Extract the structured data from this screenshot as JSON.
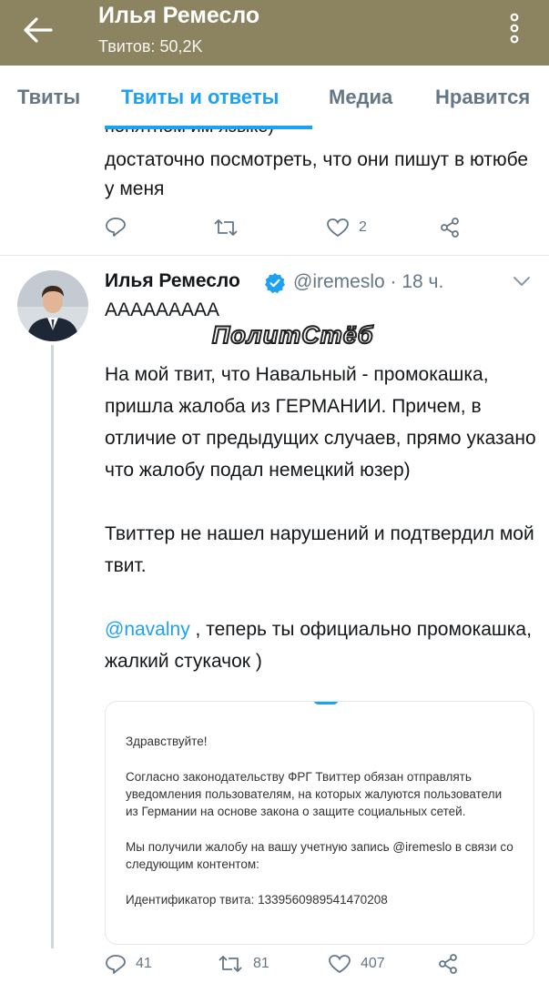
{
  "header": {
    "title": "Илья Ремесло",
    "subtitle": "Твитов: 50,2K"
  },
  "tabs": [
    {
      "label": "Твиты"
    },
    {
      "label": "Твиты и ответы"
    },
    {
      "label": "Медиа"
    },
    {
      "label": "Нравится"
    }
  ],
  "prev_tweet": {
    "cut_text": "понятном им языке)",
    "text": "достаточно посмотреть, что они пишут в ютюбе у меня",
    "likes": "2"
  },
  "tweet": {
    "name": "Илья Ремесло",
    "handle_time": "@iremeslo · 18 ч.",
    "line1": "АААААААAА",
    "watermark": "ПолитСтёб",
    "p1": "На мой твит, что Навальный - промокашка, пришла жалоба из ГЕРМАНИИ. Причем, в отличие от предыдущих случаев, прямо указано что жалобу подал немецкий юзер)",
    "p2": "Твиттер не нашел нарушений и подтвердил мой твит.",
    "mention": "@navalny",
    "p3_rest": " , теперь ты официально промокашка, жалкий стукачок )",
    "replies": "41",
    "retweets": "81",
    "likes": "407"
  },
  "card": {
    "greeting": "Здравствуйте!",
    "para1": "Согласно законодательству ФРГ Твиттер обязан отправлять уведомления пользователям, на которых жалуются пользователи из Германии на основе закона о защите социальных сетей.",
    "para2": "Мы получили жалобу на вашу учетную запись @iremeslo в связи со следующим контентом:",
    "para3": "Идентификатор твита: 1339560989541470208"
  },
  "colors": {
    "header_bg": "#8c8460",
    "accent": "#1da1f2",
    "muted": "#657786"
  }
}
